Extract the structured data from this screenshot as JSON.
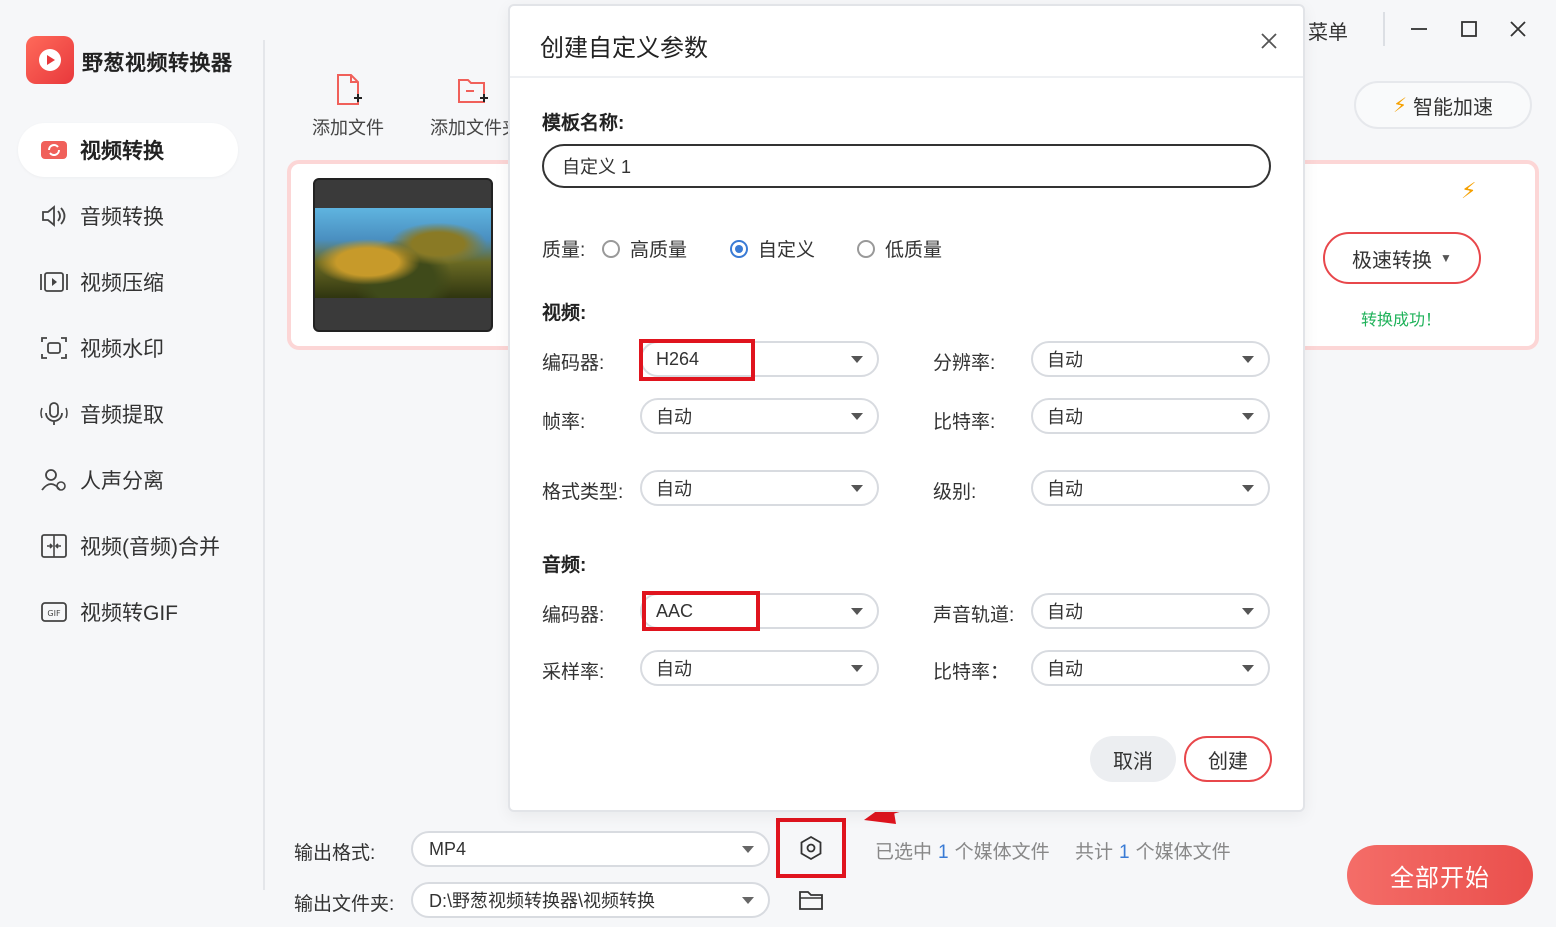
{
  "app": {
    "title": "野葱视频转换器"
  },
  "sidebar": {
    "items": [
      {
        "label": "视频转换",
        "icon": "video-convert-icon",
        "active": true
      },
      {
        "label": "音频转换",
        "icon": "audio-convert-icon"
      },
      {
        "label": "视频压缩",
        "icon": "video-compress-icon"
      },
      {
        "label": "视频水印",
        "icon": "video-watermark-icon"
      },
      {
        "label": "音频提取",
        "icon": "audio-extract-icon"
      },
      {
        "label": "人声分离",
        "icon": "vocal-separate-icon"
      },
      {
        "label": "视频(音频)合并",
        "icon": "merge-icon"
      },
      {
        "label": "视频转GIF",
        "icon": "gif-icon"
      }
    ]
  },
  "toolbar": {
    "add_file": "添加文件",
    "add_folder": "添加文件夹"
  },
  "window": {
    "menu": "菜单"
  },
  "smart_accel": {
    "label": "智能加速"
  },
  "file_card": {
    "convert_mode": "极速转换",
    "status": "转换成功！"
  },
  "bottom": {
    "output_format_label": "输出格式:",
    "output_format_value": "MP4",
    "output_folder_label": "输出文件夹:",
    "output_folder_value": "D:\\野葱视频转换器\\视频转换",
    "selected_prefix": "已选中",
    "selected_count": "1",
    "selected_suffix": "个媒体文件",
    "total_prefix": "共计",
    "total_count": "1",
    "total_suffix": "个媒体文件",
    "start_all": "全部开始"
  },
  "dialog": {
    "title": "创建自定义参数",
    "template_name_label": "模板名称:",
    "template_name_value": "自定义 1",
    "quality_label": "质量:",
    "quality_options": [
      "高质量",
      "自定义",
      "低质量"
    ],
    "quality_selected": "自定义",
    "video_section": "视频:",
    "video": {
      "codec_label": "编码器:",
      "codec_value": "H264",
      "resolution_label": "分辨率:",
      "resolution_value": "自动",
      "framerate_label": "帧率:",
      "framerate_value": "自动",
      "bitrate_label": "比特率:",
      "bitrate_value": "自动",
      "format_type_label": "格式类型:",
      "format_type_value": "自动",
      "level_label": "级别:",
      "level_value": "自动"
    },
    "audio_section": "音频:",
    "audio": {
      "codec_label": "编码器:",
      "codec_value": "AAC",
      "channels_label": "声音轨道:",
      "channels_value": "自动",
      "samplerate_label": "采样率:",
      "samplerate_value": "自动",
      "bitrate_label": "比特率：",
      "bitrate_value": "自动"
    },
    "cancel": "取消",
    "create": "创建"
  },
  "colors": {
    "accent": "#e8474b",
    "brand": "#ea4f4c",
    "success": "#1fb25a",
    "highlight": "#e0141e",
    "link": "#3a7bd5"
  }
}
